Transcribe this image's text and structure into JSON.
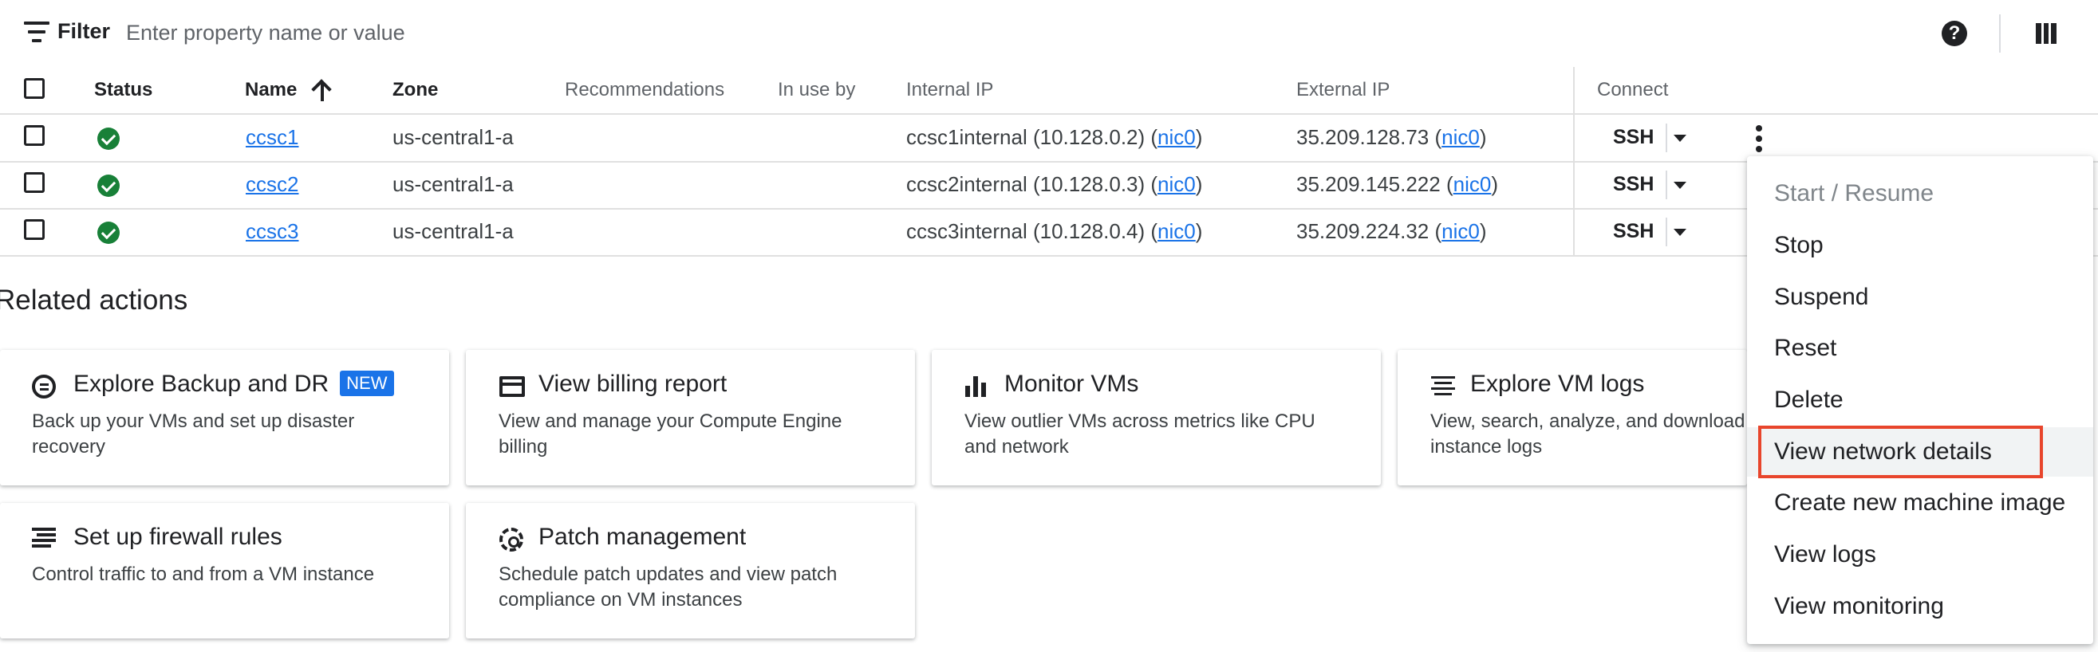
{
  "toolbar": {
    "filter_label": "Filter",
    "filter_placeholder": "Enter property name or value",
    "help_icon": "help-icon",
    "columns_icon": "column-display-icon"
  },
  "table": {
    "headers": {
      "status": "Status",
      "name": "Name",
      "zone": "Zone",
      "recommendations": "Recommendations",
      "in_use_by": "In use by",
      "internal_ip": "Internal IP",
      "external_ip": "External IP",
      "connect": "Connect"
    },
    "rows": [
      {
        "name": "ccsc1",
        "zone": "us-central1-a",
        "internal_host": "ccsc1internal (10.128.0.2) (",
        "internal_nic": "nic0",
        "external_ip": "35.209.128.73 (",
        "external_nic": "nic0",
        "connect": "SSH"
      },
      {
        "name": "ccsc2",
        "zone": "us-central1-a",
        "internal_host": "ccsc2internal (10.128.0.3) (",
        "internal_nic": "nic0",
        "external_ip": "35.209.145.222 (",
        "external_nic": "nic0",
        "connect": "SSH"
      },
      {
        "name": "ccsc3",
        "zone": "us-central1-a",
        "internal_host": "ccsc3internal (10.128.0.4) (",
        "internal_nic": "nic0",
        "external_ip": "35.209.224.32 (",
        "external_nic": "nic0",
        "connect": "SSH"
      }
    ],
    "close_paren": ")",
    "status_color": "#188038",
    "link_color": "#1a73e8"
  },
  "related": {
    "title": "Related actions",
    "cards": [
      {
        "title": "Explore Backup and DR",
        "badge": "NEW",
        "desc_lines": [
          "Back up your VMs and set up disaster",
          "recovery"
        ],
        "icon": "backup-icon"
      },
      {
        "title": "View billing report",
        "desc_lines": [
          "View and manage your Compute Engine",
          "billing"
        ],
        "icon": "billing-icon"
      },
      {
        "title": "Monitor VMs",
        "desc_lines": [
          "View outlier VMs across metrics like CPU",
          "and network"
        ],
        "icon": "monitoring-icon"
      },
      {
        "title": "Explore VM logs",
        "desc_lines": [
          "View, search, analyze, and download V",
          "instance logs"
        ],
        "icon": "logs-icon"
      },
      {
        "title": "Set up firewall rules",
        "desc_lines": [
          "Control traffic to and from a VM instance"
        ],
        "icon": "firewall-icon"
      },
      {
        "title": "Patch management",
        "desc_lines": [
          "Schedule patch updates and view patch",
          "compliance on VM instances"
        ],
        "icon": "patch-icon"
      }
    ]
  },
  "menu": {
    "items": [
      {
        "label": "Start / Resume",
        "disabled": true
      },
      {
        "label": "Stop"
      },
      {
        "label": "Suspend"
      },
      {
        "label": "Reset"
      },
      {
        "label": "Delete"
      },
      {
        "label": "View network details",
        "highlighted": true
      },
      {
        "label": "Create new machine image"
      },
      {
        "label": "View logs"
      },
      {
        "label": "View monitoring"
      }
    ],
    "highlight_color": "#e8452c"
  }
}
